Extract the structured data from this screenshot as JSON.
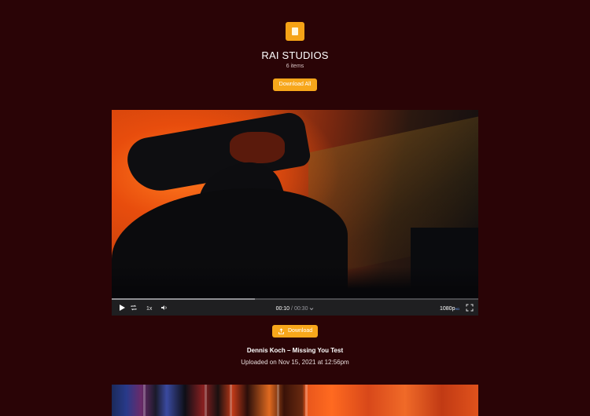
{
  "header": {
    "logo_icon": "document-icon",
    "title": "RAI STUDIOS",
    "item_count": "6 items",
    "download_all_label": "Download All"
  },
  "player": {
    "current_time": "00:10",
    "separator": "/",
    "duration": "00:30",
    "speed": "1x",
    "quality": "1080p",
    "quality_badge": "HD",
    "progress_fraction": 0.39,
    "icons": [
      "play-icon",
      "loop-icon",
      "volume-icon",
      "chevron-down-icon",
      "fullscreen-icon"
    ]
  },
  "item": {
    "download_label": "Download",
    "download_icon": "upload-tray-icon",
    "title": "Dennis Koch – Missing You Test",
    "uploaded": "Uploaded on Nov 15, 2021 at 12:56pm"
  },
  "colors": {
    "background": "#2a0406",
    "accent": "#f7a71b",
    "controls_bar": "#1f1f21"
  }
}
